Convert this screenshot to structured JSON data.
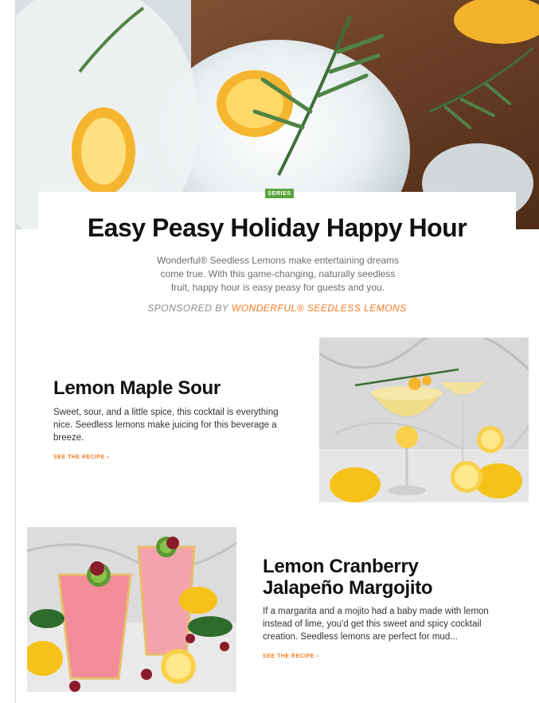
{
  "hero": {
    "badge": "SERIES",
    "title": "Easy Peasy Holiday Happy Hour",
    "description": "Wonderful® Seedless Lemons make entertaining dreams come true. With this game-changing, naturally seedless fruit, happy hour is easy peasy for guests and you.",
    "sponsor_prefix": "SPONSORED BY ",
    "sponsor_name": "WONDERFUL® SEEDLESS LEMONS"
  },
  "recipes": [
    {
      "title": "Lemon Maple Sour",
      "description": "Sweet, sour, and a little spice, this cocktail is everything nice. Seedless lemons make juicing for this beverage a breeze.",
      "link_label": "SEE THE RECIPE ›"
    },
    {
      "title": "Lemon Cranberry Jalapeño Margojito",
      "description": "If a margarita and a mojito had a baby made with lemon instead of lime, you'd get this sweet and spicy cocktail creation. Seedless lemons are perfect for mud...",
      "link_label": "SEE THE RECIPE ›"
    }
  ],
  "colors": {
    "accent_orange": "#f47b20",
    "badge_green": "#5aa53b",
    "title_text": "#111111",
    "body_text": "#333333"
  },
  "icons": {
    "link_chevron": "chevron-right-icon"
  }
}
